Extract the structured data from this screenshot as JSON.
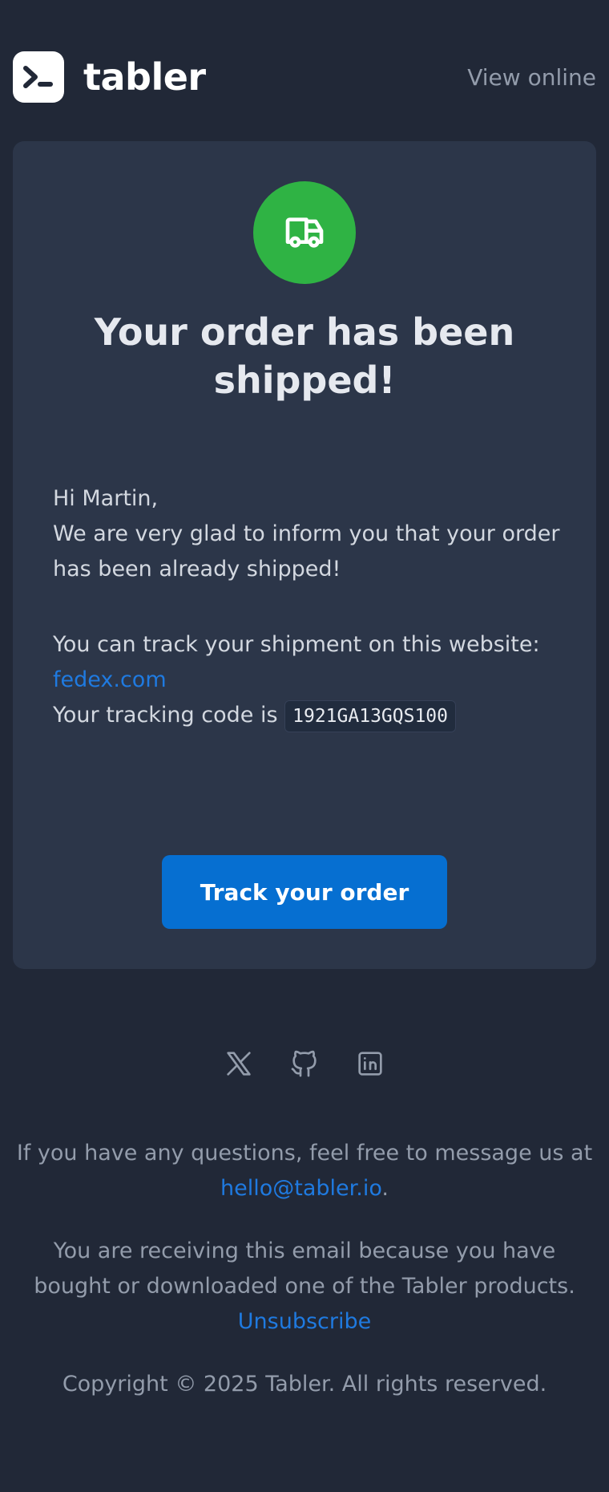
{
  "header": {
    "brand_name": "tabler",
    "view_online": "View online"
  },
  "card": {
    "title": "Your order has been shipped!",
    "greeting": "Hi Martin,",
    "message": "We are very glad to inform you that your order has been already shipped!",
    "track_intro": "You can track your shipment on this website:",
    "track_link": "fedex.com",
    "tracking_code_label": "Your tracking code is",
    "tracking_code": "1921GA13GQS100",
    "button_label": "Track your order"
  },
  "social": {
    "icons": [
      "x-icon",
      "github-icon",
      "linkedin-icon"
    ]
  },
  "footer": {
    "questions_text": "If you have any questions, feel free to message us at",
    "contact_email": "hello@tabler.io",
    "period": ".",
    "receiving_text": "You are receiving this email because you have bought or downloaded one of the Tabler products.",
    "unsubscribe": "Unsubscribe",
    "copyright": "Copyright © 2025 Tabler. All rights reserved."
  },
  "colors": {
    "background": "#212837",
    "card": "#2c3649",
    "accent_green": "#2fb344",
    "primary_blue": "#066fd1",
    "link_blue": "#1f7ae0",
    "muted_text": "#939cab"
  }
}
